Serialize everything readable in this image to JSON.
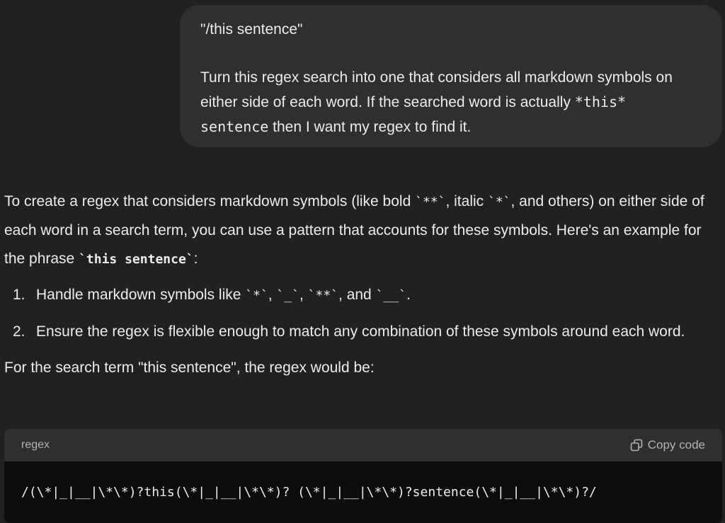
{
  "user_message": {
    "line1": "\"/this sentence\"",
    "para2_text": "Turn this regex search into one that considers all markdown symbols on either side of each word. If the searched word is actually ",
    "para2_code": "*this* sentence",
    "para2_tail": " then I want my regex to find it."
  },
  "assistant": {
    "intro_part1": "To create a regex that considers markdown symbols (like bold ",
    "intro_code_bold": "`**`",
    "intro_part2": ", italic ",
    "intro_code_italic": "`*`",
    "intro_part3": ", and others) on either side of each word in a search term, you can use a pattern that accounts for these symbols. Here's an example for the phrase ",
    "intro_code_phrase": "`this sentence`",
    "intro_part4": ":",
    "steps": [
      {
        "num": "1.",
        "text_a": "Handle markdown symbols like ",
        "code_a": "`*`",
        "sep_a": ", ",
        "code_b": "`_`",
        "sep_b": ", ",
        "code_c": "`**`",
        "sep_c": ", and ",
        "code_d": "`__`",
        "end": "."
      },
      {
        "num": "2.",
        "text": "Ensure the regex is flexible enough to match any combination of these symbols around each word."
      }
    ],
    "final_text": "For the search term \"this sentence\", the regex would be:"
  },
  "code_block": {
    "language": "regex",
    "copy_label": "Copy code",
    "code": "/(\\*|_|__|\\*\\*)?this(\\*|_|__|\\*\\*)? (\\*|_|__|\\*\\*)?sentence(\\*|_|__|\\*\\*)?/"
  },
  "icons": {
    "copy": "copy-icon"
  },
  "colors": {
    "background": "#212121",
    "user_bubble": "#2f2f2f",
    "code_header": "#2f2f2f",
    "code_body": "#0d0d0d",
    "text": "#ececec",
    "muted": "#b4b4b4"
  }
}
